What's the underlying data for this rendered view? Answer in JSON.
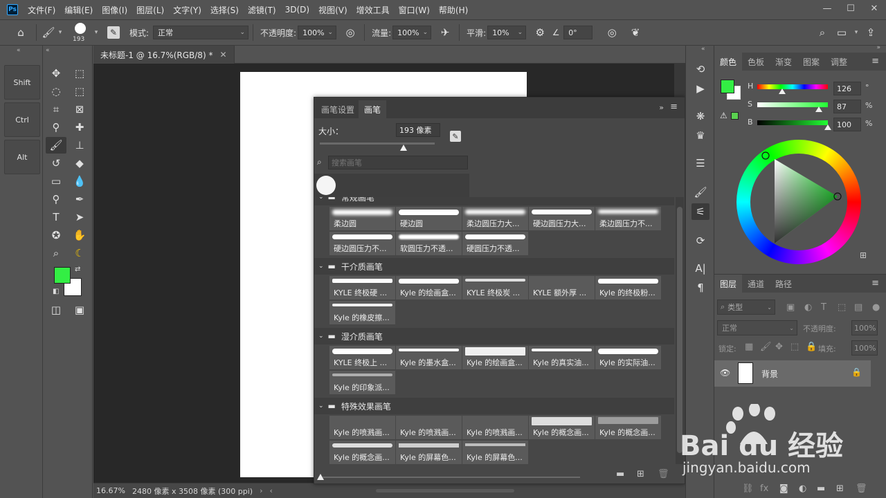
{
  "app": {
    "logo": "Ps"
  },
  "menu": [
    "文件(F)",
    "编辑(E)",
    "图像(I)",
    "图层(L)",
    "文字(Y)",
    "选择(S)",
    "滤镜(T)",
    "3D(D)",
    "视图(V)",
    "增效工具",
    "窗口(W)",
    "帮助(H)"
  ],
  "options": {
    "brush_size": "193",
    "mode_label": "模式:",
    "mode_value": "正常",
    "opacity_label": "不透明度:",
    "opacity_value": "100%",
    "flow_label": "流量:",
    "flow_value": "100%",
    "smooth_label": "平滑:",
    "smooth_value": "10%",
    "angle_value": "0°"
  },
  "touch_keys": [
    "Shift",
    "Ctrl",
    "Alt"
  ],
  "colors": {
    "foreground": "#33ee44",
    "background": "#ffffff"
  },
  "document": {
    "tab_title": "未标题-1 @ 16.7%(RGB/8) *",
    "zoom": "16.67%",
    "info": "2480 像素 x 3508 像素 (300 ppi)"
  },
  "brush_panel": {
    "tab_settings": "画笔设置",
    "tab_brushes": "画笔",
    "size_label": "大小：",
    "size_value": "193 像素",
    "search_placeholder": "搜索画笔",
    "groups": [
      {
        "name": "常规画笔",
        "brushes": [
          "柔边圆",
          "硬边圆",
          "柔边圆压力大...",
          "硬边圆压力大...",
          "柔边圆压力不...",
          "硬边圆压力不...",
          "软圆压力不透...",
          "硬圆压力不透..."
        ]
      },
      {
        "name": "干介质画笔",
        "brushes": [
          "KYLE 终极硬 ...",
          "Kyle 的绘画盒...",
          "KYLE 终极炭 ...",
          "KYLE 额外厚 ...",
          "Kyle 的终极粉...",
          "Kyle 的橡皮擦..."
        ]
      },
      {
        "name": "湿介质画笔",
        "brushes": [
          "KYLE 终极上 ...",
          "Kyle 的墨水盒...",
          "Kyle 的绘画盒...",
          "Kyle 的真实油...",
          "Kyle 的实际油...",
          "Kyle 的印象派..."
        ]
      },
      {
        "name": "特殊效果画笔",
        "brushes": [
          "Kyle 的喷溅画...",
          "Kyle 的喷溅画...",
          "Kyle 的喷溅画...",
          "Kyle 的概念画...",
          "Kyle 的概念画...",
          "Kyle 的概念画...",
          "Kyle 的屏幕色...",
          "Kyle 的屏幕色..."
        ]
      }
    ]
  },
  "color_panel": {
    "tabs": [
      "颜色",
      "色板",
      "渐变",
      "图案",
      "调整"
    ],
    "h_label": "H",
    "h_value": "126",
    "h_unit": "°",
    "s_label": "S",
    "s_value": "87",
    "s_unit": "%",
    "b_label": "B",
    "b_value": "100",
    "b_unit": "%",
    "h_level": 0.35,
    "s_level": 0.87,
    "b_level": 1.0
  },
  "layers_panel": {
    "tabs": [
      "图层",
      "通道",
      "路径"
    ],
    "filter_label": "类型",
    "blend_mode": "正常",
    "opacity_label": "不透明度:",
    "opacity_value": "100%",
    "lock_label": "锁定:",
    "fill_label": "填充:",
    "fill_value": "100%",
    "layer_name": "背景"
  },
  "watermark": {
    "text": "Bai du 经验",
    "url": "jingyan.baidu.com"
  }
}
